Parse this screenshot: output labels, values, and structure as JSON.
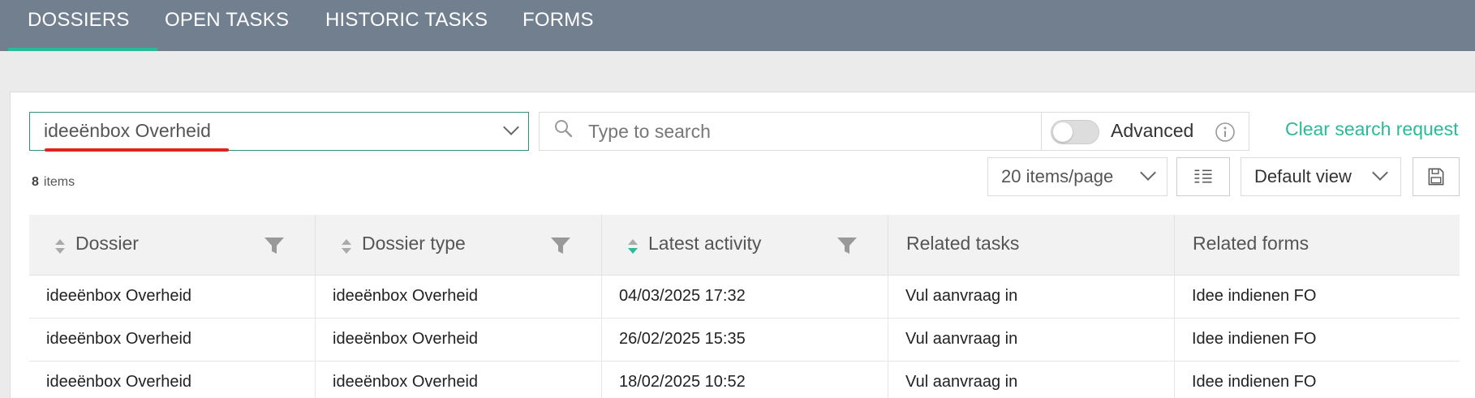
{
  "nav": {
    "tabs": [
      {
        "label": "DOSSIERS",
        "active": true
      },
      {
        "label": "OPEN TASKS",
        "active": false
      },
      {
        "label": "HISTORIC TASKS",
        "active": false
      },
      {
        "label": "FORMS",
        "active": false
      }
    ]
  },
  "toolbar": {
    "dossier_select_value": "ideeënbox Overheid",
    "search_placeholder": "Type to search",
    "advanced_label": "Advanced",
    "advanced_enabled": false,
    "clear_label": "Clear search request",
    "count_value": "8",
    "count_label": "items",
    "items_per_page": "20 items/page",
    "view_value": "Default view"
  },
  "table": {
    "columns": [
      "Dossier",
      "Dossier type",
      "Latest activity",
      "Related tasks",
      "Related forms"
    ],
    "rows": [
      [
        "ideeënbox Overheid",
        "ideeënbox Overheid",
        "04/03/2025 17:32",
        "Vul aanvraag in",
        "Idee indienen FO"
      ],
      [
        "ideeënbox Overheid",
        "ideeënbox Overheid",
        "26/02/2025 15:35",
        "Vul aanvraag in",
        "Idee indienen FO"
      ],
      [
        "ideeënbox Overheid",
        "ideeënbox Overheid",
        "18/02/2025 10:52",
        "Vul aanvraag in",
        "Idee indienen FO"
      ]
    ]
  },
  "colors": {
    "nav_bg": "#727f8e",
    "accent": "#2bb99a",
    "error_underline": "#e0231c"
  }
}
